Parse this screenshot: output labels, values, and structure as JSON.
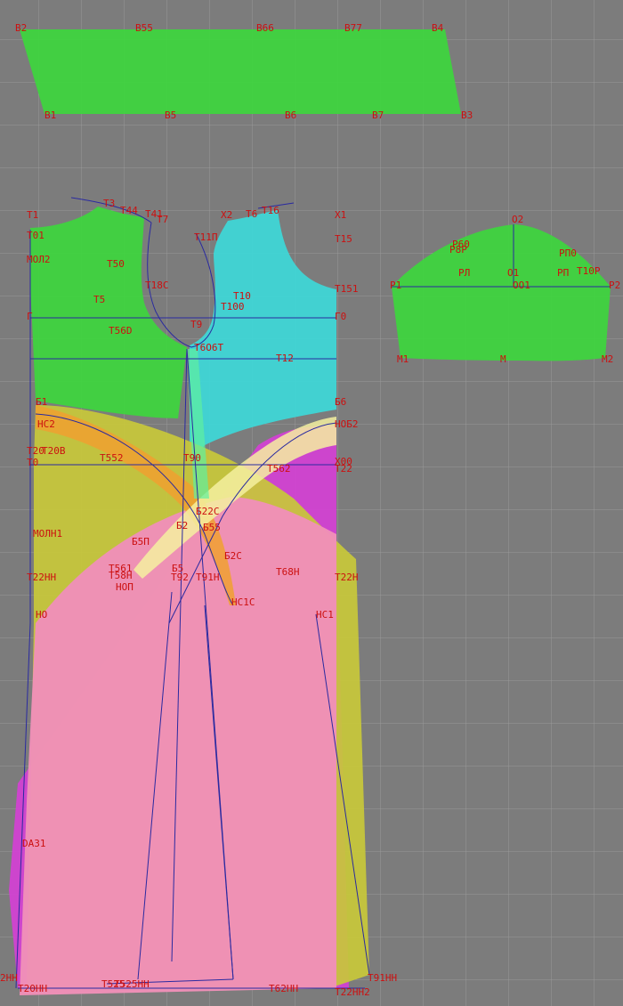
{
  "colors": {
    "background": "#7c7c7c",
    "grid": "#999999",
    "label": "#cc1010",
    "construction_line": "#2a2aa0",
    "piece_green": "#3fd43f",
    "piece_cyan": "#3fd6d6",
    "piece_magenta": "#d63fd6",
    "piece_pink": "#f090b8",
    "piece_yellow": "#c8c83a",
    "piece_orange": "#f0a030"
  },
  "point_labels": {
    "belt": [
      "B2",
      "B55",
      "B66",
      "B77",
      "B4",
      "B1",
      "B5",
      "B6",
      "B7",
      "B3"
    ],
    "front": [
      "T1",
      "T3",
      "T44",
      "T41",
      "T7",
      "X2",
      "T6",
      "T16",
      "X1",
      "T11П",
      "T01",
      "T15",
      "МОЛ2",
      "T50",
      "T18C",
      "T151",
      "T5",
      "T10",
      "T100",
      "Г",
      "Г0",
      "T56D",
      "T9",
      "T6O6T",
      "T12",
      "Б1",
      "Б6",
      "HC2",
      "HOБ2",
      "T20",
      "T20B",
      "T552",
      "T90",
      "T562",
      "T22",
      "X00",
      "T0",
      "МОЛН1",
      "Б22С",
      "Б2",
      "Б5П",
      "Б55",
      "Б2С",
      "Б5",
      "T561",
      "T58H",
      "T92",
      "T91H",
      "T68H",
      "НОП",
      "T22HH",
      "T22H",
      "HC1C",
      "HO",
      "HC1",
      "DA31",
      "2HH",
      "T91HH",
      "T20HH",
      "T525",
      "T525HH",
      "T62HH",
      "T22HH2"
    ],
    "sleeve": [
      "O2",
      "P60",
      "P8P",
      "PП0",
      "PЛ",
      "O1",
      "PП",
      "T10P",
      "P1",
      "P2",
      "OO1",
      "M1",
      "M",
      "M2"
    ]
  }
}
